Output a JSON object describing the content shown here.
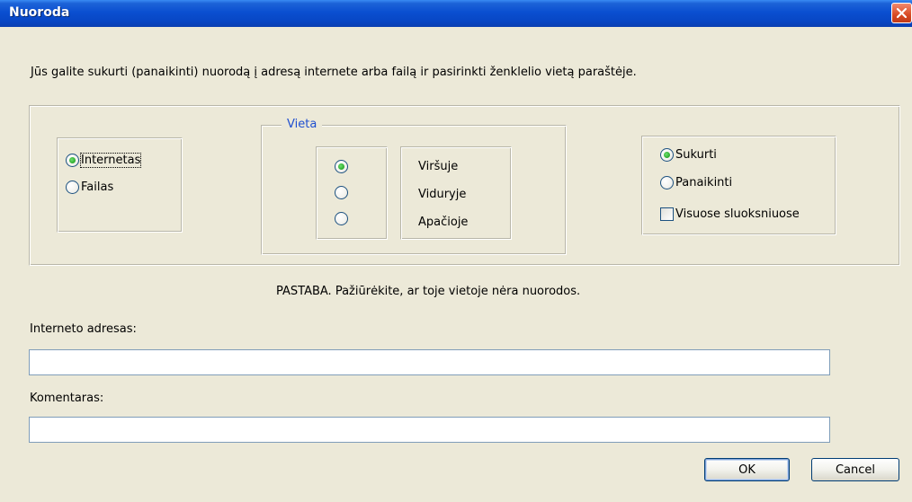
{
  "window": {
    "title": "Nuoroda",
    "close_icon": "close-x-icon"
  },
  "description": "Jūs galite sukurti (panaikinti)  nuorodą į adresą internete arba failą ir pasirinkti ženklelio vietą paraštėje.",
  "link_type": {
    "options": [
      {
        "label": "Internetas",
        "checked": true
      },
      {
        "label": "Failas",
        "checked": false
      }
    ]
  },
  "placement": {
    "legend": "Vieta",
    "options": [
      {
        "label": "Viršuje",
        "checked": true
      },
      {
        "label": "Viduryje",
        "checked": false
      },
      {
        "label": "Apačioje",
        "checked": false
      }
    ]
  },
  "action": {
    "options": [
      {
        "label": "Sukurti",
        "checked": true
      },
      {
        "label": "Panaikinti",
        "checked": false
      }
    ],
    "all_layers": {
      "label": "Visuose sluoksniuose",
      "checked": false
    }
  },
  "note": "PASTABA. Pažiūrėkite, ar toje vietoje nėra nuorodos.",
  "fields": {
    "url_label": "Interneto adresas:",
    "url_value": "",
    "comment_label": "Komentaras:",
    "comment_value": ""
  },
  "buttons": {
    "ok": "OK",
    "cancel": "Cancel"
  },
  "colors": {
    "titlebar": "#0a4fd0",
    "window_bg": "#ece9d8",
    "legend_text": "#1f4fd0",
    "radio_checked": "#2aa92a"
  }
}
